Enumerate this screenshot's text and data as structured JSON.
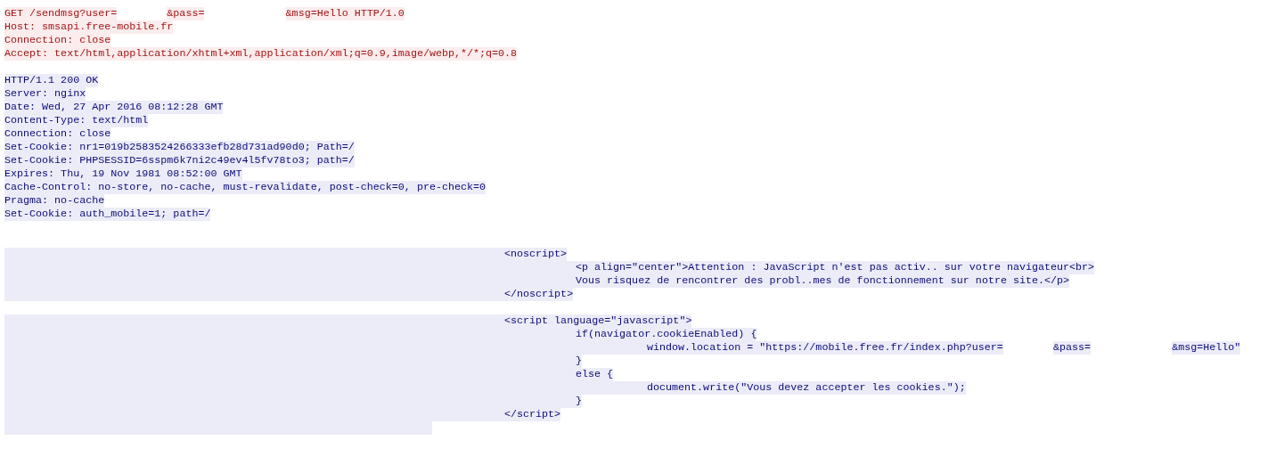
{
  "request": {
    "lines": [
      {
        "parts": [
          {
            "text": "GET /sendmsg?user="
          },
          {
            "kind": "redacted_short"
          },
          {
            "text": "&pass="
          },
          {
            "kind": "redacted_long"
          },
          {
            "text": "&msg=Hello HTTP/1.0"
          }
        ]
      },
      {
        "parts": [
          {
            "text": "Host: smsapi.free-mobile.fr"
          }
        ]
      },
      {
        "parts": [
          {
            "text": "Connection: close"
          }
        ]
      },
      {
        "parts": [
          {
            "text": "Accept: text/html,application/xhtml+xml,application/xml;q=0.9,image/webp,*/*;q=0.8"
          }
        ]
      }
    ]
  },
  "response": {
    "headers": [
      {
        "parts": [
          {
            "text": "HTTP/1.1 200 OK"
          }
        ]
      },
      {
        "parts": [
          {
            "text": "Server: nginx"
          }
        ]
      },
      {
        "parts": [
          {
            "text": "Date: Wed, 27 Apr 2016 08:12:28 GMT"
          }
        ]
      },
      {
        "parts": [
          {
            "text": "Content-Type: text/html"
          }
        ]
      },
      {
        "parts": [
          {
            "text": "Connection: close"
          }
        ]
      },
      {
        "parts": [
          {
            "text": "Set-Cookie: nr1=019b2583524266333efb28d731ad90d0; Path=/"
          }
        ]
      },
      {
        "parts": [
          {
            "text": "Set-Cookie: PHPSESSID=6sspm6k7ni2c49ev4l5fv78to3; path=/"
          }
        ]
      },
      {
        "parts": [
          {
            "text": "Expires: Thu, 19 Nov 1981 08:52:00 GMT"
          }
        ]
      },
      {
        "parts": [
          {
            "text": "Cache-Control: no-store, no-cache, must-revalidate, post-check=0, pre-check=0"
          }
        ]
      },
      {
        "parts": [
          {
            "text": "Pragma: no-cache"
          }
        ]
      },
      {
        "parts": [
          {
            "text": "Set-Cookie: auth_mobile=1; path=/"
          }
        ]
      }
    ],
    "body": [
      {
        "lines": [
          {
            "parts": [
              {
                "text": "<noscript>"
              }
            ],
            "children": [
              {
                "parts": [
                  {
                    "text": "<p align=\"center\">Attention : JavaScript n'est pas activ.. sur votre navigateur<br>"
                  }
                ]
              },
              {
                "parts": [
                  {
                    "text": "Vous risquez de rencontrer des probl..mes de fonctionnement sur notre site.</p>"
                  }
                ]
              }
            ]
          },
          {
            "parts": [
              {
                "text": "</noscript>"
              }
            ]
          }
        ]
      },
      {
        "lines": [
          {
            "parts": [
              {
                "text": "<script language=\"javascript\">"
              }
            ],
            "children": [
              {
                "parts": [
                  {
                    "text": "if(navigator.cookieEnabled) {"
                  }
                ],
                "children": [
                  {
                    "parts": [
                      {
                        "text": "window.location = \"https://mobile.free.fr/index.php?user="
                      },
                      {
                        "kind": "redacted_short"
                      },
                      {
                        "text": "&pass="
                      },
                      {
                        "kind": "redacted_long"
                      },
                      {
                        "text": "&msg=Hello\""
                      }
                    ]
                  }
                ]
              },
              {
                "parts": [
                  {
                    "text": "}"
                  }
                ]
              },
              {
                "parts": [
                  {
                    "text": "else {"
                  }
                ],
                "children": [
                  {
                    "parts": [
                      {
                        "text": "document.write(\"Vous devez accepter les cookies.\");"
                      }
                    ]
                  }
                ]
              },
              {
                "parts": [
                  {
                    "text": "}"
                  }
                ]
              }
            ]
          },
          {
            "parts": [
              {
                "text": "</script>"
              }
            ]
          },
          {
            "kind": "blank"
          }
        ]
      }
    ]
  }
}
